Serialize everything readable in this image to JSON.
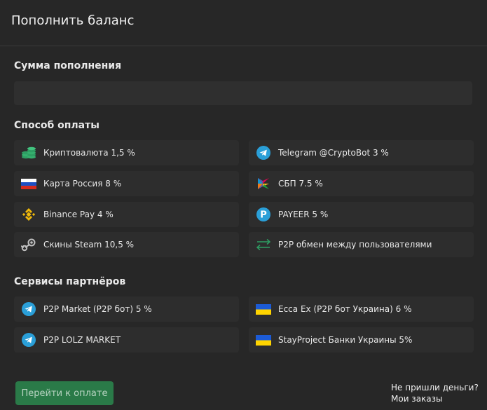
{
  "header": {
    "title": "Пополнить баланс"
  },
  "amount": {
    "label": "Сумма пополнения",
    "value": ""
  },
  "payment": {
    "label": "Способ оплаты",
    "methods": [
      {
        "label": "Криптовалюта 1,5 %",
        "icon": "coins-icon"
      },
      {
        "label": "Telegram @CryptoBot 3 %",
        "icon": "telegram-icon"
      },
      {
        "label": "Карта Россия 8 %",
        "icon": "russia-flag-icon"
      },
      {
        "label": "СБП 7.5 %",
        "icon": "sbp-icon"
      },
      {
        "label": "Binance Pay 4 %",
        "icon": "binance-icon"
      },
      {
        "label": "PAYEER 5 %",
        "icon": "payeer-icon"
      },
      {
        "label": "Скины Steam 10,5 %",
        "icon": "steam-icon"
      },
      {
        "label": "P2P обмен между пользователями",
        "icon": "exchange-arrows-icon"
      }
    ]
  },
  "partners": {
    "label": "Сервисы партнёров",
    "items": [
      {
        "label": "P2P Market (P2P бот) 5 %",
        "icon": "telegram-icon"
      },
      {
        "label": "Ecca Ex (P2P бот Украина) 6 %",
        "icon": "ukraine-flag-icon"
      },
      {
        "label": "P2P LOLZ MARKET",
        "icon": "telegram-icon"
      },
      {
        "label": "StayProject Банки Украины 5%",
        "icon": "ukraine-flag-icon"
      }
    ]
  },
  "footer": {
    "pay_button": "Перейти к оплате",
    "no_money_link": "Не пришли деньги?",
    "orders_link": "Мои заказы"
  },
  "colors": {
    "background": "#272727",
    "option_bg": "#2d2d2d",
    "button_green": "#2a7a48",
    "telegram_blue": "#2a9fd8",
    "binance_yellow": "#f0b90b",
    "money_green": "#2e9e63"
  }
}
